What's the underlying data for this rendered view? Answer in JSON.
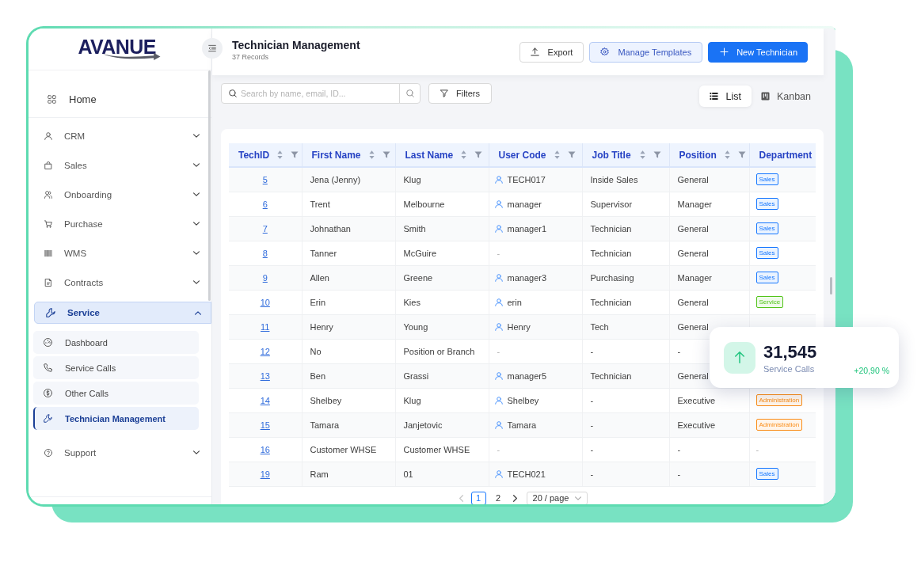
{
  "logo": {
    "text": "AVANUE"
  },
  "sidebar": {
    "items": [
      {
        "kind": "link",
        "label": "Home",
        "selected": false
      },
      {
        "kind": "group",
        "label": "CRM",
        "selected": false,
        "expanded": false
      },
      {
        "kind": "group",
        "label": "Sales",
        "selected": false,
        "expanded": false
      },
      {
        "kind": "group",
        "label": "Onboarding",
        "selected": false,
        "expanded": false
      },
      {
        "kind": "group",
        "label": "Purchase",
        "selected": false,
        "expanded": false
      },
      {
        "kind": "group",
        "label": "WMS",
        "selected": false,
        "expanded": false
      },
      {
        "kind": "group",
        "label": "Contracts",
        "selected": false,
        "expanded": false
      },
      {
        "kind": "group",
        "label": "Service",
        "selected": true,
        "expanded": true,
        "children": [
          {
            "label": "Dashboard",
            "selected": false
          },
          {
            "label": "Service Calls",
            "selected": false
          },
          {
            "label": "Other Calls",
            "selected": false
          },
          {
            "label": "Technician Management",
            "selected": true
          }
        ]
      },
      {
        "kind": "group",
        "label": "Support",
        "selected": false,
        "expanded": false
      }
    ]
  },
  "header": {
    "title": "Technician Management",
    "subtitle": "37 Records",
    "buttons": [
      {
        "label": "Export",
        "kind": "outline"
      },
      {
        "label": "Manage Templates",
        "kind": "soft"
      },
      {
        "label": "New Technician",
        "kind": "primary"
      }
    ]
  },
  "toolbar": {
    "search": {
      "placeholder": "Search by name, email, ID..."
    },
    "filters_button": {
      "label": "Filters"
    },
    "views": [
      {
        "label": "List",
        "selected": true
      },
      {
        "label": "Kanban",
        "selected": false
      }
    ]
  },
  "table": {
    "columns": [
      {
        "label": "TechID",
        "sortable": true,
        "filterable": true
      },
      {
        "label": "First Name",
        "sortable": true,
        "filterable": true
      },
      {
        "label": "Last Name",
        "sortable": true,
        "filterable": true
      },
      {
        "label": "User Code",
        "sortable": true,
        "filterable": true
      },
      {
        "label": "Job Title",
        "sortable": true,
        "filterable": true
      },
      {
        "label": "Position",
        "sortable": true,
        "filterable": true
      },
      {
        "label": "Department",
        "sortable": false,
        "filterable": false
      }
    ],
    "rows": [
      {
        "tech_id": "5",
        "first_name": "Jena (Jenny)",
        "last_name": "Klug",
        "user_code": {
          "kind": "user",
          "text": "TECH017"
        },
        "job_title": "Inside Sales",
        "position": "General",
        "department": {
          "kind": "tag",
          "label": "Sales",
          "color": "#1677ff"
        }
      },
      {
        "tech_id": "6",
        "first_name": "Trent",
        "last_name": "Melbourne",
        "user_code": {
          "kind": "user",
          "text": "manager"
        },
        "job_title": "Supervisor",
        "position": "Manager",
        "department": {
          "kind": "tag",
          "label": "Sales",
          "color": "#1677ff"
        }
      },
      {
        "tech_id": "7",
        "first_name": "Johnathan",
        "last_name": "Smith",
        "user_code": {
          "kind": "user",
          "text": "manager1"
        },
        "job_title": "Technician",
        "position": "General",
        "department": {
          "kind": "tag",
          "label": "Sales",
          "color": "#1677ff"
        }
      },
      {
        "tech_id": "8",
        "first_name": "Tanner",
        "last_name": "McGuire",
        "user_code": {
          "kind": "empty",
          "text": "-"
        },
        "job_title": "Technician",
        "position": "General",
        "department": {
          "kind": "tag",
          "label": "Sales",
          "color": "#1677ff"
        }
      },
      {
        "tech_id": "9",
        "first_name": "Allen",
        "last_name": "Greene",
        "user_code": {
          "kind": "user",
          "text": "manager3"
        },
        "job_title": "Purchasing",
        "position": "Manager",
        "department": {
          "kind": "tag",
          "label": "Sales",
          "color": "#1677ff"
        }
      },
      {
        "tech_id": "10",
        "first_name": "Erin",
        "last_name": "Kies",
        "user_code": {
          "kind": "user",
          "text": "erin"
        },
        "job_title": "Technician",
        "position": "General",
        "department": {
          "kind": "tag",
          "label": "Service",
          "color": "#52c41a"
        }
      },
      {
        "tech_id": "11",
        "first_name": "Henry",
        "last_name": "Young",
        "user_code": {
          "kind": "user",
          "text": "Henry"
        },
        "job_title": "Tech",
        "position": "General"
      },
      {
        "tech_id": "12",
        "first_name": "No",
        "last_name": "Position or Branch",
        "user_code": {
          "kind": "empty",
          "text": "-"
        },
        "job_title": "-",
        "position": "-"
      },
      {
        "tech_id": "13",
        "first_name": "Ben",
        "last_name": "Grassi",
        "user_code": {
          "kind": "user",
          "text": "manager5"
        },
        "job_title": "Technician",
        "position": "General"
      },
      {
        "tech_id": "14",
        "first_name": "Shelbey",
        "last_name": "Klug",
        "user_code": {
          "kind": "user",
          "text": "Shelbey"
        },
        "job_title": "-",
        "position": "Executive",
        "department": {
          "kind": "tag",
          "label": "Administration",
          "color": "#fa8c16"
        }
      },
      {
        "tech_id": "15",
        "first_name": "Tamara",
        "last_name": "Janjetovic",
        "user_code": {
          "kind": "user",
          "text": "Tamara"
        },
        "job_title": "-",
        "position": "Executive",
        "department": {
          "kind": "tag",
          "label": "Administration",
          "color": "#fa8c16"
        }
      },
      {
        "tech_id": "16",
        "first_name": "Customer WHSE",
        "last_name": "Customer WHSE",
        "user_code": {
          "kind": "empty",
          "text": "-"
        },
        "job_title": "-",
        "position": "-",
        "department": {
          "kind": "empty",
          "label": "-"
        }
      },
      {
        "tech_id": "19",
        "first_name": "Ram",
        "last_name": "01",
        "user_code": {
          "kind": "user",
          "text": "TECH021"
        },
        "job_title": "-",
        "position": "-",
        "department": {
          "kind": "tag",
          "label": "Sales",
          "color": "#1677ff"
        }
      }
    ]
  },
  "pagination": {
    "prev_disabled": true,
    "next_disabled": false,
    "pages": [
      {
        "label": "1",
        "selected": true
      },
      {
        "label": "2",
        "selected": false
      }
    ],
    "page_size": "20 / page"
  },
  "stat_card": {
    "value": "31,545",
    "label": "Service Calls",
    "change": "+20,90 %"
  }
}
